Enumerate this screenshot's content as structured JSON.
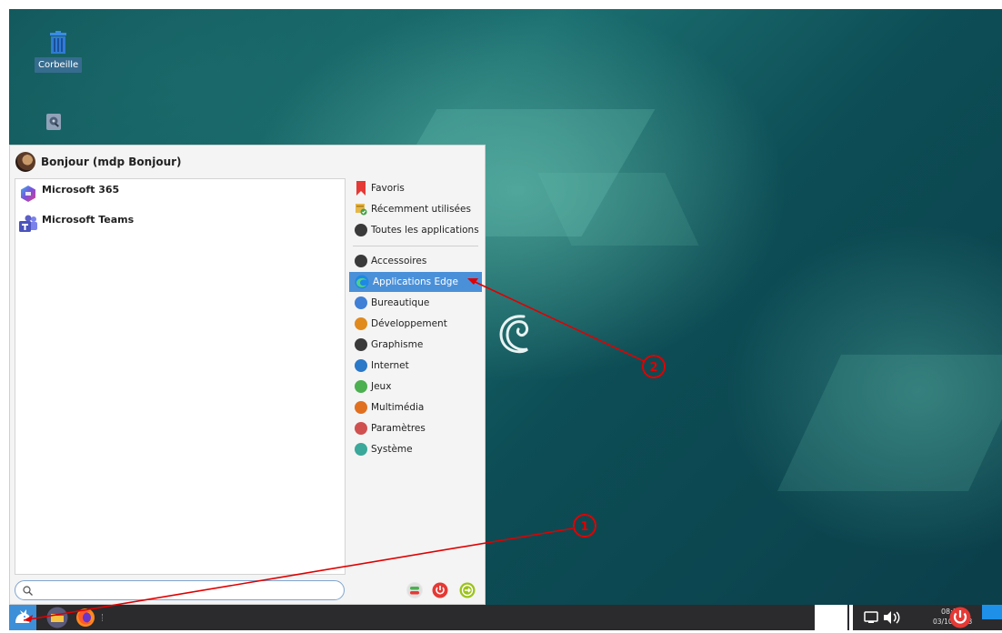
{
  "desktop": {
    "icons": [
      {
        "label": "Corbeille",
        "icon": "trash-icon"
      },
      {
        "label": "",
        "icon": "drive-icon"
      }
    ]
  },
  "menu": {
    "user_name": "Bonjour (mdp Bonjour)",
    "apps": [
      {
        "label": "Microsoft 365",
        "icon": "microsoft-365-icon"
      },
      {
        "label": "Microsoft Teams",
        "icon": "microsoft-teams-icon"
      }
    ],
    "quick_categories": [
      {
        "label": "Favoris",
        "icon": "bookmark-icon"
      },
      {
        "label": "Récemment utilisées",
        "icon": "recent-icon"
      },
      {
        "label": "Toutes les applications",
        "icon": "all-apps-icon"
      }
    ],
    "categories": [
      {
        "label": "Accessoires",
        "icon": "accessories-icon",
        "color": "#3a3a3a"
      },
      {
        "label": "Applications Edge",
        "icon": "edge-icon",
        "color": "#1e88e5",
        "selected": true
      },
      {
        "label": "Bureautique",
        "icon": "office-icon",
        "color": "#3f7fd6"
      },
      {
        "label": "Développement",
        "icon": "development-icon",
        "color": "#e08a1e"
      },
      {
        "label": "Graphisme",
        "icon": "graphics-icon",
        "color": "#3a3a3a"
      },
      {
        "label": "Internet",
        "icon": "internet-icon",
        "color": "#2a78c8"
      },
      {
        "label": "Jeux",
        "icon": "games-icon",
        "color": "#4caf50"
      },
      {
        "label": "Multimédia",
        "icon": "multimedia-icon",
        "color": "#e07020"
      },
      {
        "label": "Paramètres",
        "icon": "settings-icon",
        "color": "#d05050"
      },
      {
        "label": "Système",
        "icon": "system-icon",
        "color": "#3aa89a"
      }
    ],
    "search": {
      "value": "",
      "placeholder": ""
    },
    "bottom_buttons": [
      {
        "icon": "settings-toggle-icon",
        "color": "#4caf50"
      },
      {
        "icon": "power-icon",
        "color": "#e53935"
      },
      {
        "icon": "logout-icon",
        "color": "#9cc31a"
      }
    ]
  },
  "taskbar": {
    "time": "08:10",
    "date": "03/10/2023"
  },
  "annotations": {
    "marker_1": "1",
    "marker_2": "2",
    "color": "#e00000"
  }
}
